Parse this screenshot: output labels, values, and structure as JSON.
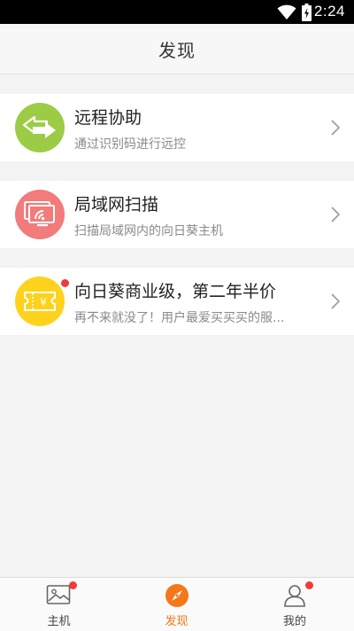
{
  "status_bar": {
    "time": "2:24"
  },
  "header": {
    "title": "发现"
  },
  "items": [
    {
      "title": "远程协助",
      "subtitle": "通过识别码进行远控",
      "icon": "arrows-exchange-icon",
      "color": "#9ccc45"
    },
    {
      "title": "局域网扫描",
      "subtitle": "扫描局域网内的向日葵主机",
      "icon": "lan-scan-icon",
      "color": "#f27b7b"
    },
    {
      "title": "向日葵商业级，第二年半价",
      "subtitle": "再不来就没了！用户最爱买买买的服...",
      "icon": "ticket-yen-icon",
      "color": "#ffd21c",
      "has_badge": true
    }
  ],
  "tabs": [
    {
      "label": "主机",
      "icon": "picture-icon",
      "has_badge": true
    },
    {
      "label": "发现",
      "icon": "compass-icon",
      "active": true
    },
    {
      "label": "我的",
      "icon": "person-icon",
      "has_badge": true
    }
  ],
  "colors": {
    "accent": "#f4771a",
    "badge": "#f23a3a"
  }
}
